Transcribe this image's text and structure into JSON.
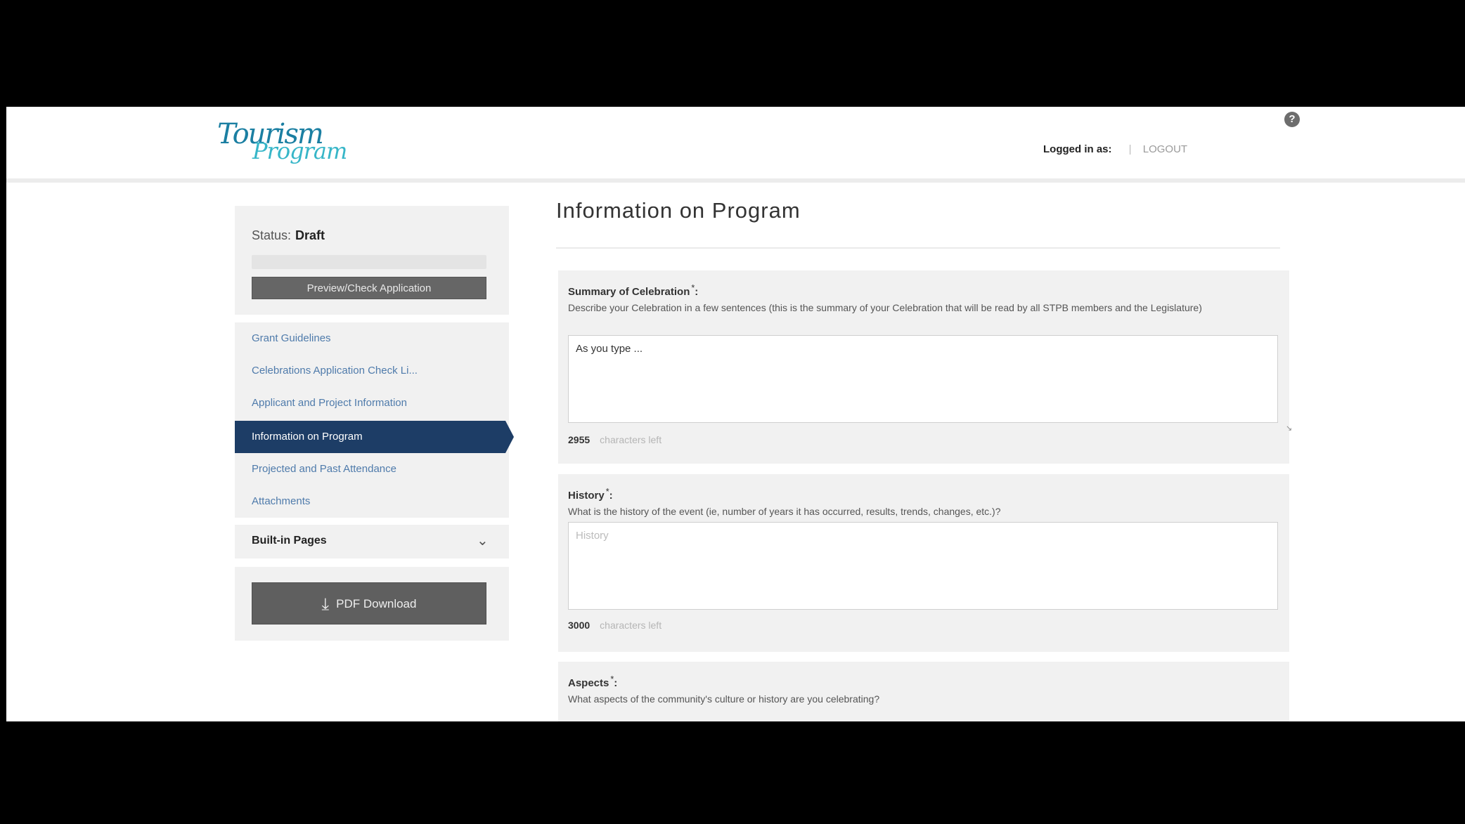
{
  "header": {
    "logo_line_small": "",
    "logo_line1": "Tourism",
    "logo_line2": "Program",
    "help_icon": "question-circle-icon",
    "logged_in_label": "Logged in as:",
    "logged_in_user": "",
    "logout_label": "LOGOUT"
  },
  "sidebar": {
    "status_label": "Status:",
    "status_value": "Draft",
    "progress_percent": 0,
    "preview_button": "Preview/Check Application",
    "nav_items": [
      {
        "label": "Grant Guidelines"
      },
      {
        "label": "Celebrations Application Check Li..."
      },
      {
        "label": "Applicant and Project Information"
      },
      {
        "label": "Information on Program"
      },
      {
        "label": "Projected and Past Attendance"
      },
      {
        "label": "Attachments"
      }
    ],
    "builtin_pages_label": "Built-in Pages",
    "pdf_button": "PDF Download"
  },
  "main": {
    "page_title": "Information on Program",
    "sections": [
      {
        "label": "Summary of Celebration",
        "required_mark": "*",
        "description": "Describe your Celebration in a few sentences (this is the summary of your Celebration that will be read by all STPB members and the Legislature)",
        "value": "As you type ...",
        "placeholder": "",
        "counter_value": "2955",
        "counter_suffix": "characters left"
      },
      {
        "label": "History",
        "required_mark": "*",
        "description": "What is the history of the event (ie, number of years it has occurred, results, trends, changes, etc.)?",
        "value": "",
        "placeholder": "History",
        "counter_value": "3000",
        "counter_suffix": "characters left"
      },
      {
        "label": "Aspects",
        "required_mark": "*",
        "description": "What aspects of the community's culture or history are you celebrating?"
      }
    ]
  },
  "colors": {
    "nav_active": "#1d3d66",
    "nav_link": "#4f7bab",
    "logo_primary": "#1b7fa2",
    "logo_secondary": "#37b6c8",
    "button_dark": "#666666"
  }
}
